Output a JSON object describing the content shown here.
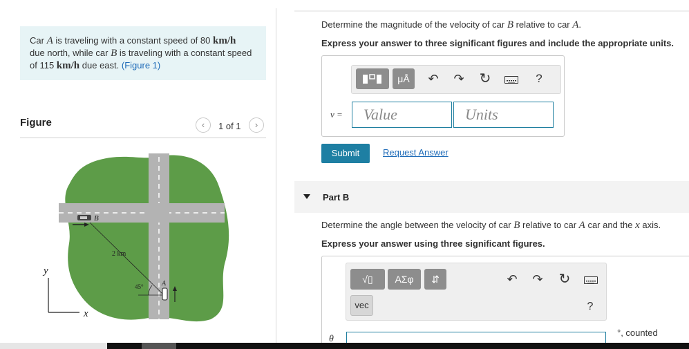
{
  "problem": {
    "text_1": "Car ",
    "car_a": "A",
    "text_2": " is traveling with a constant speed of 80 ",
    "unit_1": "km/h",
    "text_3": "due north, while car ",
    "car_b": "B",
    "text_4": " is traveling with a constant speed",
    "text_5": "of 115 ",
    "unit_2": "km/h",
    "text_6": " due east. ",
    "figure_link": "(Figure 1)"
  },
  "figure": {
    "label": "Figure",
    "pager_text": "1 of 1",
    "prev_icon": "chevron-left-icon",
    "next_icon": "chevron-right-icon",
    "diagram": {
      "label_b": "B",
      "label_a": "A",
      "distance": "2 km",
      "angle": "45°",
      "axis_y": "y",
      "axis_x": "x"
    }
  },
  "partA": {
    "question_1": "Determine the magnitude of the velocity of car ",
    "question_b": "B",
    "question_2": " relative to car ",
    "question_a": "A",
    "question_3": ".",
    "instruction": "Express your answer to three significant figures and include the appropriate units.",
    "toolbar": {
      "templates_icon": "templates-icon",
      "units_btn": "μÅ",
      "undo_icon": "undo-icon",
      "redo_icon": "redo-icon",
      "reset_icon": "reset-icon",
      "keyboard_icon": "keyboard-icon",
      "help": "?"
    },
    "v_label": "v =",
    "value_placeholder": "Value",
    "units_placeholder": "Units",
    "submit": "Submit",
    "request": "Request Answer"
  },
  "partB": {
    "label": "Part B",
    "question_1": "Determine the angle between the velocity of car ",
    "question_b": "B",
    "question_2": " relative to car ",
    "question_a": "A",
    "question_3": " car and the ",
    "question_x": "x",
    "question_4": " axis.",
    "instruction": "Express your answer using three significant figures.",
    "toolbar": {
      "sqrt_btn": "√▯",
      "greek_btn": "ΑΣφ",
      "arrows_btn": "⇵",
      "vec_btn": "vec",
      "help": "?"
    },
    "theta_label": "θ",
    "counted": "°, counted"
  },
  "colors": {
    "accent": "#1e7fa3",
    "problem_bg": "#e7f4f6",
    "map_green": "#5d9c48",
    "road_gray": "#b3b3b3"
  }
}
